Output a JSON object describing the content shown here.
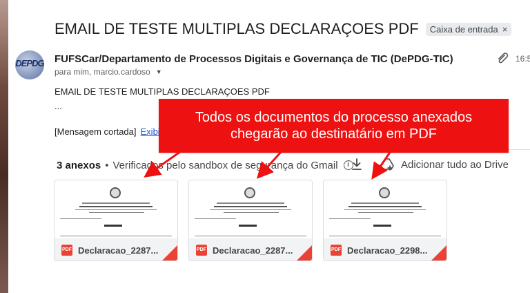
{
  "email": {
    "subject": "EMAIL DE TESTE MULTIPLAS DECLARAÇOES PDF",
    "label": "Caixa de entrada",
    "label_close": "×",
    "sender": "FUFSCar/Departamento de Processos Digitais e Governança de TIC (DePDG-TIC)",
    "recipients": "para mim, marcio.cardoso",
    "time": "16:5",
    "avatar_text": "DEPDG",
    "body_lines": [
      "EMAIL DE TESTE MULTIPLAS DECLARAÇOES PDF",
      "..."
    ],
    "truncated_text": "[Mensagem cortada]",
    "truncated_link": "Exibi"
  },
  "attachments": {
    "count": "3 anexos",
    "separator": "•",
    "scan_note": "Verificados pelo sandbox de segurança do Gmail",
    "drive_label": "Adicionar tudo ao Drive",
    "files": [
      {
        "name": "Declaracao_2287...",
        "type": "PDF"
      },
      {
        "name": "Declaracao_2287...",
        "type": "PDF"
      },
      {
        "name": "Declaracao_2298...",
        "type": "PDF"
      }
    ]
  },
  "annotation": {
    "line1": "Todos os documentos do processo anexados",
    "line2": "chegarão ao destinatário em PDF"
  },
  "colors": {
    "callout": "#ee1111",
    "pdf": "#ea4335",
    "link": "#1a56c9"
  }
}
